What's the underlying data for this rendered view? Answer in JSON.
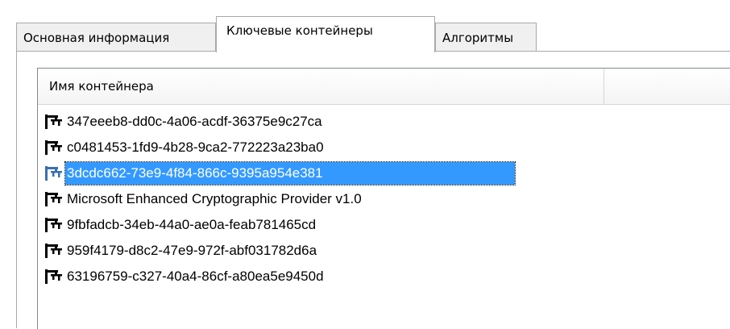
{
  "tabs": [
    {
      "label": "Основная информация",
      "active": false
    },
    {
      "label": "Ключевые контейнеры",
      "active": true
    },
    {
      "label": "Алгоритмы",
      "active": false
    }
  ],
  "list": {
    "column_header": "Имя контейнера",
    "items": [
      {
        "label": "347eeeb8-dd0c-4a06-acdf-36375e9c27ca",
        "icon": "key-container-icon",
        "selected": false
      },
      {
        "label": "c0481453-1fd9-4b28-9ca2-772223a23ba0",
        "icon": "key-container-icon",
        "selected": false
      },
      {
        "label": "3dcdc662-73e9-4f84-866c-9395a954e381",
        "icon": "key-container-icon",
        "selected": true
      },
      {
        "label": "Microsoft Enhanced Cryptographic Provider v1.0",
        "icon": "key-container-icon",
        "selected": false
      },
      {
        "label": "9fbfadcb-34eb-44a0-ae0a-feab781465cd",
        "icon": "key-container-icon",
        "selected": false
      },
      {
        "label": "959f4179-d8c2-47e9-972f-abf031782d6a",
        "icon": "key-container-icon",
        "selected": false
      },
      {
        "label": "63196759-c327-40a4-86cf-a80ea5e9450d",
        "icon": "key-container-icon",
        "selected": false
      }
    ]
  },
  "colors": {
    "selection": "#3399ff",
    "tab_border": "#a9a9a9"
  }
}
